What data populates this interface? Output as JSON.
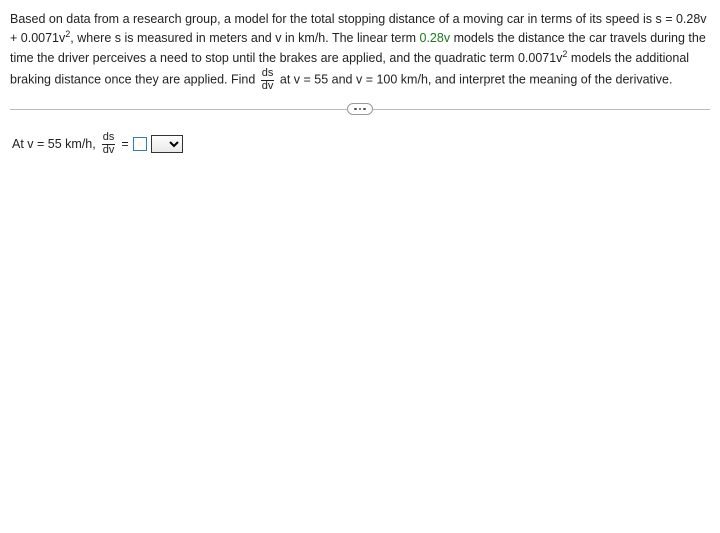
{
  "problem": {
    "p1_a": "Based on data from a research group, a model for the total stopping distance of a moving car in terms of its speed is ",
    "eq1_a": "s = 0.28v + 0.0071v",
    "eq1_exp": "2",
    "p1_b": ", where s is measured in meters and v in km/h. The linear term ",
    "linear_term": "0.28v",
    "p1_c": " models the distance the car travels during the time the driver perceives a need to stop until the brakes are applied, and the quadratic term ",
    "quad_a": "0.0071v",
    "quad_exp": "2",
    "p1_d": " models the additional braking distance once they are applied. Find ",
    "frac_num": "ds",
    "frac_den": "dv",
    "p1_e": " at v = 55 and v = 100 km/h, and interpret the meaning of the derivative."
  },
  "answer": {
    "prefix": "At v = 55 km/h, ",
    "frac_num": "ds",
    "frac_den": "dv",
    "equals": " = ",
    "input_value": "",
    "select_value": ""
  }
}
